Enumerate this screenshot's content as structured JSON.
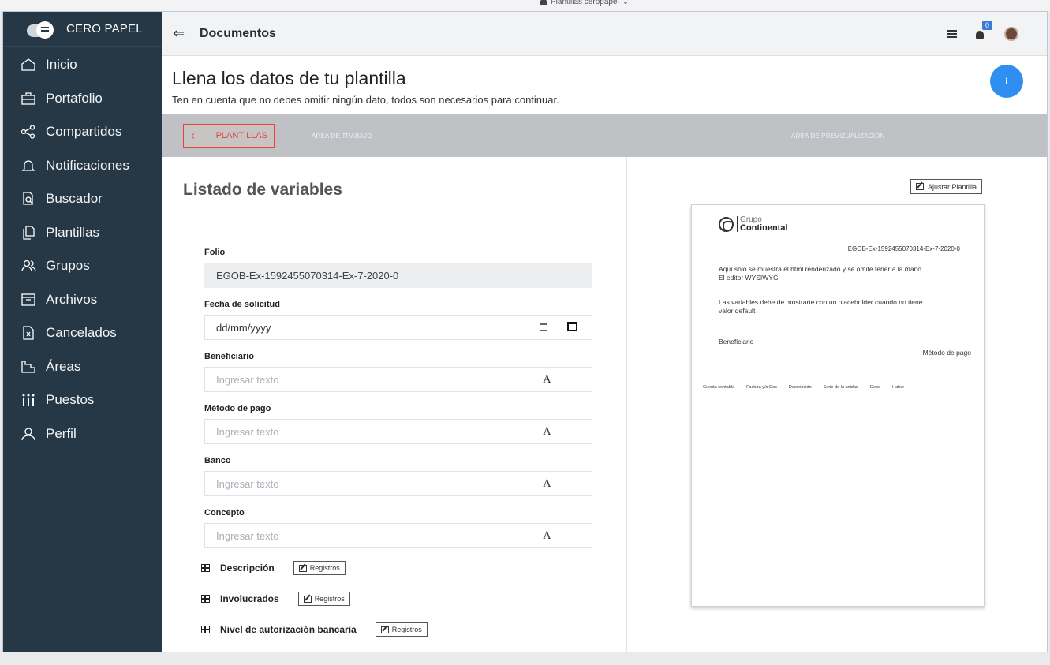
{
  "window_caption": "Plantillas ceropapel",
  "brand": {
    "name": "CERO PAPEL"
  },
  "sidebar": {
    "items": [
      {
        "label": "Inicio",
        "icon": "home-icon"
      },
      {
        "label": "Portafolio",
        "icon": "briefcase-icon"
      },
      {
        "label": "Compartidos",
        "icon": "share-icon"
      },
      {
        "label": "Notificaciones",
        "icon": "bell-icon"
      },
      {
        "label": "Buscador",
        "icon": "search-document-icon"
      },
      {
        "label": "Plantillas",
        "icon": "copy-icon"
      },
      {
        "label": "Grupos",
        "icon": "group-icon"
      },
      {
        "label": "Archivos",
        "icon": "archive-icon"
      },
      {
        "label": "Cancelados",
        "icon": "cancelled-file-icon"
      },
      {
        "label": "Áreas",
        "icon": "area-icon"
      },
      {
        "label": "Puestos",
        "icon": "positions-icon"
      },
      {
        "label": "Perfil",
        "icon": "user-icon"
      }
    ]
  },
  "header": {
    "title": "Documentos",
    "notification_count": "0"
  },
  "intro": {
    "title": "Llena los datos de tu plantilla",
    "subtitle": "Ten en cuenta que no debes omitir ningún dato, todos son necesarios para continuar.",
    "info_label": "i"
  },
  "toolbar": {
    "back_label": "PLANTILLAS",
    "work_area": "ÁREA DE TRABAJO",
    "preview_area": "ÁREA DE PREVIZUALIZACIÓN"
  },
  "variables": {
    "title": "Listado de variables",
    "fields": [
      {
        "label": "Folio",
        "value": "EGOB-Ex-1592455070314-Ex-7-2020-0",
        "placeholder": ""
      },
      {
        "label": "Fecha de solicitud",
        "value": "dd/mm/yyyy",
        "placeholder": ""
      },
      {
        "label": "Beneficiario",
        "value": "",
        "placeholder": "Ingresar texto"
      },
      {
        "label": "Método de pago",
        "value": "",
        "placeholder": "Ingresar texto"
      },
      {
        "label": "Banco",
        "value": "",
        "placeholder": "Ingresar texto"
      },
      {
        "label": "Concepto",
        "value": "",
        "placeholder": "Ingresar texto"
      }
    ],
    "text_icon_glyph": "A",
    "tables": [
      {
        "label": "Descripción",
        "button": "Registros"
      },
      {
        "label": "Involucrados",
        "button": "Registros"
      },
      {
        "label": "Nivel de autorización bancaria",
        "button": "Registros"
      }
    ]
  },
  "preview": {
    "adjust_button": "Ajustar Plantilla",
    "logo_top": "Grupo",
    "logo_bottom": "Continental",
    "folio": "EGOB-Ex-1592455070314-Ex-7-2020-0",
    "p1_line1": "Aquí solo se muestra el html renderizado y se omite tener a la mano",
    "p1_line2": "El editor WYSIWYG",
    "p2_line1": "Las variables debe de mostrarte con un placeholder cuando no tiene",
    "p2_line2": "valor default",
    "beneficiario": "Beneficiario",
    "metodo": "Método de pago",
    "columns": [
      "Cuenta contable",
      "Factura y/o Doc",
      "Descripción",
      "Serie de la unidad",
      "Debe",
      "Haber"
    ]
  }
}
